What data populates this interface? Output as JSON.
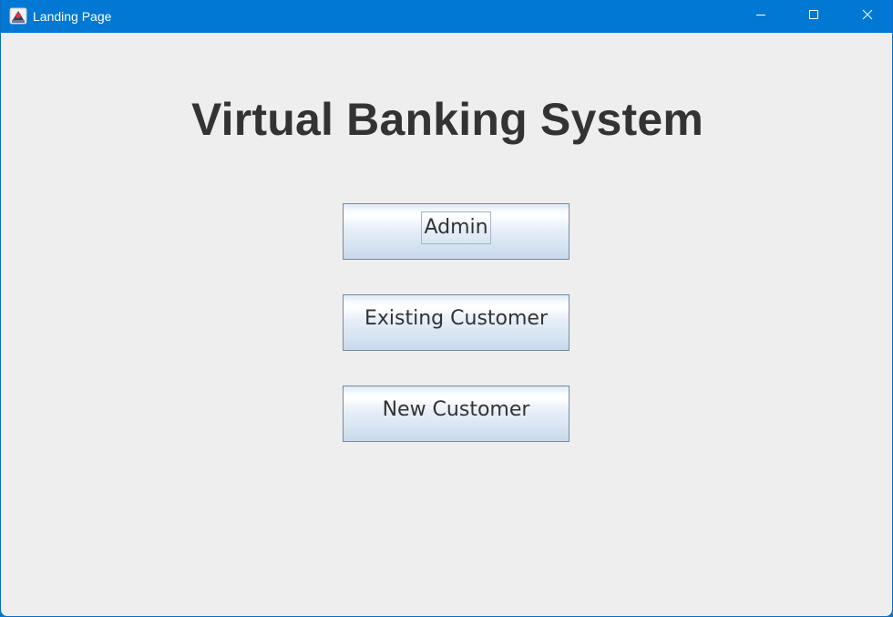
{
  "window": {
    "title": "Landing Page",
    "icon": "java-app-icon",
    "controls": [
      "minimize-icon",
      "maximize-icon",
      "close-icon"
    ]
  },
  "main": {
    "heading": "Virtual Banking System",
    "buttons": {
      "admin": "Admin",
      "existing_customer": "Existing Customer",
      "new_customer": "New Customer"
    },
    "focused_button": "admin"
  },
  "colors": {
    "titlebar": "#0078d4",
    "background": "#eeeeee",
    "heading_text": "#333333",
    "button_border": "#7a8a9e"
  }
}
